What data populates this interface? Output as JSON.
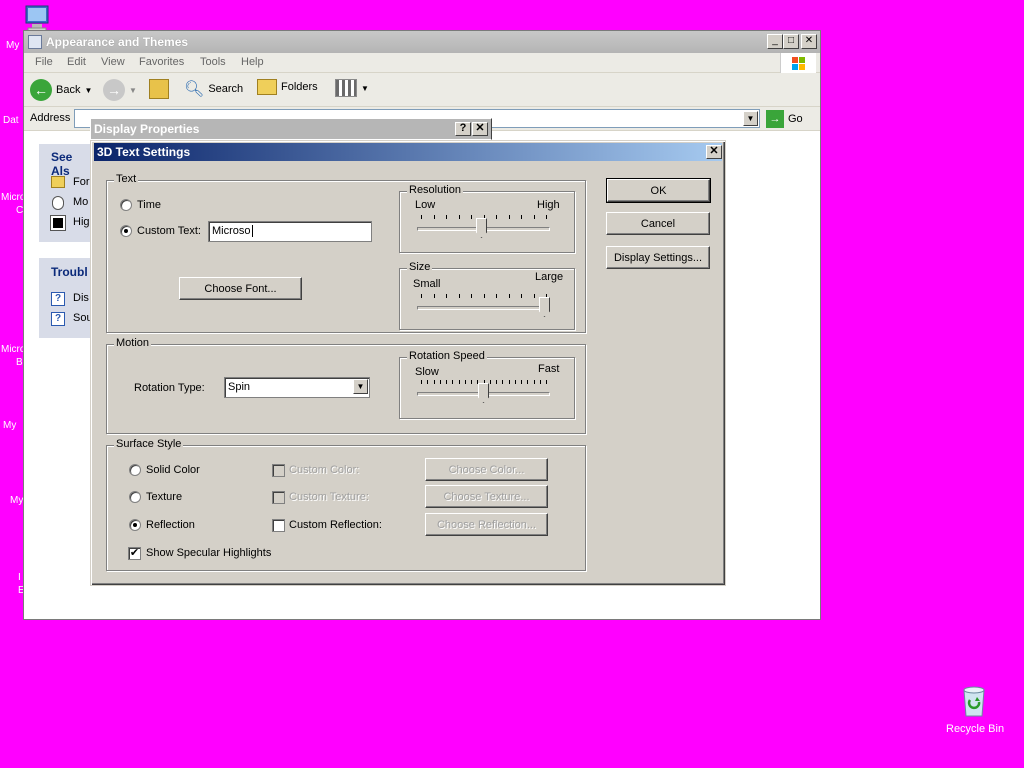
{
  "desktop": {
    "icons": [
      {
        "label": "My"
      },
      {
        "label": "Dat"
      },
      {
        "label": "Micro"
      },
      {
        "label": "C"
      },
      {
        "label": "Micro"
      },
      {
        "label": "B"
      },
      {
        "label": "My"
      },
      {
        "label": "My"
      },
      {
        "label": "I"
      },
      {
        "label": "E"
      }
    ],
    "recycle_bin": "Recycle Bin"
  },
  "explorer": {
    "title": "Appearance and Themes",
    "menu": [
      "File",
      "Edit",
      "View",
      "Favorites",
      "Tools",
      "Help"
    ],
    "toolbar": {
      "back": "Back",
      "search": "Search",
      "folders": "Folders"
    },
    "address_label": "Address",
    "go_label": "Go",
    "side": {
      "see_also": "See Als",
      "see_also_items": [
        "For",
        "Mo",
        "Hig"
      ],
      "troubleshoot": "Troubl",
      "troubleshoot_items": [
        "Dis",
        "Sou"
      ]
    }
  },
  "display_properties": {
    "title": "Display Properties"
  },
  "dialog": {
    "title": "3D Text Settings",
    "text_group": {
      "legend": "Text",
      "time_label": "Time",
      "custom_text_label": "Custom Text:",
      "custom_text_value": "Microso",
      "choose_font": "Choose Font..."
    },
    "resolution": {
      "legend": "Resolution",
      "low": "Low",
      "high": "High",
      "level": 0.48
    },
    "size": {
      "legend": "Size",
      "small": "Small",
      "large": "Large",
      "level": 1.0
    },
    "motion": {
      "legend": "Motion",
      "rotation_type_label": "Rotation Type:",
      "rotation_type_value": "Spin"
    },
    "rotation_speed": {
      "legend": "Rotation Speed",
      "slow": "Slow",
      "fast": "Fast",
      "level": 0.5
    },
    "surface": {
      "legend": "Surface Style",
      "solid_color": "Solid Color",
      "texture": "Texture",
      "reflection": "Reflection",
      "custom_color": "Custom Color:",
      "custom_texture": "Custom Texture:",
      "custom_reflection": "Custom Reflection:",
      "choose_color": "Choose Color...",
      "choose_texture": "Choose Texture...",
      "choose_reflection": "Choose Reflection...",
      "specular": "Show Specular Highlights"
    },
    "buttons": {
      "ok": "OK",
      "cancel": "Cancel",
      "display_settings": "Display Settings..."
    }
  }
}
